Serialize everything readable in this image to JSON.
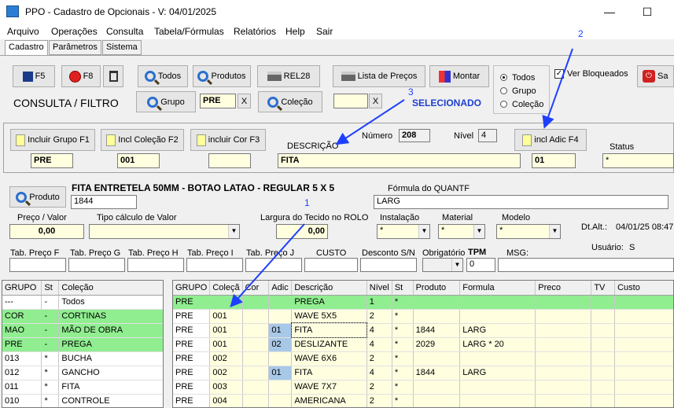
{
  "window": {
    "title": "PPO - Cadastro de Opcionais - V: 04/01/2025",
    "min": "—",
    "max": "☐"
  },
  "menu": [
    "Arquivo",
    "Operações",
    "Consulta",
    "Tabela/Fórmulas",
    "Relatórios",
    "Help",
    "Sair"
  ],
  "tabs": [
    "Cadastro",
    "Parâmetros",
    "Sistema"
  ],
  "toolbar": {
    "f5": "F5",
    "f8": "F8",
    "todos": "Todos",
    "produtos": "Produtos",
    "rel28": "REL28",
    "lista": "Lista de Preços",
    "montar": "Montar",
    "sair": "Sa"
  },
  "filter": {
    "title": "CONSULTA / FILTRO",
    "grupo_btn": "Grupo",
    "grupo_val": "PRE",
    "colecao_btn": "Coleção",
    "colecao_val": "",
    "x": "X",
    "selecionado": "SELECIONADO"
  },
  "radio": {
    "options": [
      "Todos",
      "Grupo",
      "Coleção"
    ],
    "selected": "Todos"
  },
  "ver_bloqueados": "Ver Bloqueados",
  "include": {
    "grupo_btn": "Incluir Grupo F1",
    "colecao_btn": "Incl Coleção F2",
    "cor_btn": "incluir Cor F3",
    "adic_btn": "incl Adic F4",
    "descricao_lbl": "DESCRIÇÃO",
    "numero_lbl": "Número",
    "numero_val": "208",
    "nivel_lbl": "Nível",
    "nivel_val": "4",
    "status_lbl": "Status",
    "grupo_val": "PRE",
    "colecao_val": "001",
    "cor_val": "",
    "descricao_val": "FITA",
    "adic_val": "01",
    "status_val": "*"
  },
  "produto": {
    "btn": "Produto",
    "desc": "FITA ENTRETELA 50MM - BOTAO LATAO - REGULAR 5 X 5",
    "code": "1844",
    "formula_lbl": "Fórmula do QUANTF",
    "formula_val": "LARG"
  },
  "valores": {
    "preco_lbl": "Preço / Valor",
    "preco_val": "0,00",
    "tipo_lbl": "Tipo cálculo de Valor",
    "tipo_val": "",
    "largura_lbl": "Largura do Tecido no ROLO",
    "largura_val": "0,00",
    "instal_lbl": "Instalação",
    "instal_val": "*",
    "material_lbl": "Material",
    "material_val": "*",
    "modelo_lbl": "Modelo",
    "modelo_val": "*",
    "dtalt_lbl": "Dt.Alt.:",
    "dtalt_val": "04/01/25 08:47",
    "usuario_lbl": "Usuário:",
    "usuario_val": "S"
  },
  "tabelas": {
    "f": "Tab. Preço F",
    "g": "Tab. Preço G",
    "h": "Tab. Preço H",
    "i": "Tab. Preço I",
    "j": "Tab. Preço J",
    "custo": "CUSTO",
    "desconto": "Desconto S/N",
    "obrig": "Obrigatório",
    "tpm": "TPM",
    "tpm_val": "0",
    "msg": "MSG:"
  },
  "annotations": {
    "a1": "1",
    "a2": "2",
    "a3": "3"
  },
  "left_grid": {
    "headers": [
      "GRUPO",
      "St",
      "Coleção"
    ],
    "rows": [
      [
        "---",
        "-",
        "Todos"
      ],
      [
        "COR",
        "-",
        "CORTINAS"
      ],
      [
        "MAO",
        "-",
        "MÃO DE OBRA"
      ],
      [
        "PRE",
        "-",
        "PREGA"
      ],
      [
        "013",
        "*",
        "BUCHA"
      ],
      [
        "012",
        "*",
        "GANCHO"
      ],
      [
        "011",
        "*",
        "FITA"
      ],
      [
        "010",
        "*",
        "CONTROLE"
      ]
    ]
  },
  "right_grid": {
    "headers": [
      "GRUPO",
      "Coleçã",
      "Cor",
      "Adic",
      "Descrição",
      "Nível",
      "St",
      "Produto",
      "Formula",
      "Preco",
      "TV",
      "Custo"
    ],
    "rows": [
      [
        "PRE",
        "",
        "",
        "",
        "PREGA",
        "1",
        "*",
        "",
        "",
        "",
        "",
        ""
      ],
      [
        "PRE",
        "001",
        "",
        "",
        "WAVE 5X5",
        "2",
        "*",
        "",
        "",
        "",
        "",
        ""
      ],
      [
        "PRE",
        "001",
        "",
        "01",
        "FITA",
        "4",
        "*",
        "1844",
        "LARG",
        "",
        "",
        ""
      ],
      [
        "PRE",
        "001",
        "",
        "02",
        "DESLIZANTE",
        "4",
        "*",
        "2029",
        "LARG * 20",
        "",
        "",
        ""
      ],
      [
        "PRE",
        "002",
        "",
        "",
        "WAVE 6X6",
        "2",
        "*",
        "",
        "",
        "",
        "",
        ""
      ],
      [
        "PRE",
        "002",
        "",
        "01",
        "FITA",
        "4",
        "*",
        "1844",
        "LARG",
        "",
        "",
        ""
      ],
      [
        "PRE",
        "003",
        "",
        "",
        "WAVE 7X7",
        "2",
        "*",
        "",
        "",
        "",
        "",
        ""
      ],
      [
        "PRE",
        "004",
        "",
        "",
        "AMERICANA",
        "2",
        "*",
        "",
        "",
        "",
        "",
        ""
      ]
    ]
  }
}
